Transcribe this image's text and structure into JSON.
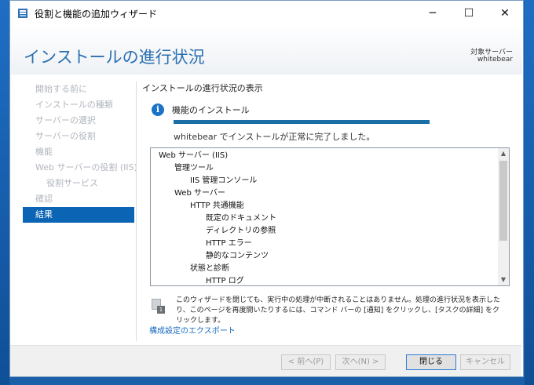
{
  "window": {
    "title": "役割と機能の追加ウィザード",
    "minimize_glyph": "─",
    "maximize_glyph": "☐",
    "close_glyph": "✕"
  },
  "header": {
    "page_title": "インストールの進行状況",
    "target_label": "対象サーバー",
    "target_server": "whitebear"
  },
  "sidebar": {
    "items": [
      {
        "label": "開始する前に",
        "sub": false,
        "active": false
      },
      {
        "label": "インストールの種類",
        "sub": false,
        "active": false
      },
      {
        "label": "サーバーの選択",
        "sub": false,
        "active": false
      },
      {
        "label": "サーバーの役割",
        "sub": false,
        "active": false
      },
      {
        "label": "機能",
        "sub": false,
        "active": false
      },
      {
        "label": "Web サーバーの役割 (IIS)",
        "sub": false,
        "active": false
      },
      {
        "label": "役割サービス",
        "sub": true,
        "active": false
      },
      {
        "label": "確認",
        "sub": false,
        "active": false
      },
      {
        "label": "結果",
        "sub": false,
        "active": true
      }
    ]
  },
  "content": {
    "section_title": "インストールの進行状況の表示",
    "info_glyph": "i",
    "feature_install_label": "機能のインストール",
    "progress_percent": 100,
    "status_text": "whitebear でインストールが正常に完了しました。"
  },
  "results": {
    "rows": [
      {
        "text": "Web サーバー (IIS)",
        "level": 0
      },
      {
        "text": "管理ツール",
        "level": 1
      },
      {
        "text": "IIS 管理コンソール",
        "level": 2
      },
      {
        "text": "Web サーバー",
        "level": 1
      },
      {
        "text": "HTTP 共通機能",
        "level": 2
      },
      {
        "text": "既定のドキュメント",
        "level": 3
      },
      {
        "text": "ディレクトリの参照",
        "level": 3
      },
      {
        "text": "HTTP エラー",
        "level": 3
      },
      {
        "text": "静的なコンテンツ",
        "level": 3
      },
      {
        "text": "状態と診断",
        "level": 2
      },
      {
        "text": "HTTP ログ",
        "level": 3
      }
    ],
    "scroll_up_glyph": "▲",
    "scroll_down_glyph": "▼"
  },
  "note": {
    "badge": "1",
    "text": "このウィザードを閉じても、実行中の処理が中断されることはありません。処理の進行状況を表示したり、このページを再度開いたりするには、コマンド バーの [通知] をクリックし、[タスクの詳細] をクリックします。"
  },
  "export_link": "構成設定のエクスポート",
  "footer": {
    "prev_label": "< 前へ(P)",
    "next_label": "次へ(N) >",
    "close_label": "閉じる",
    "cancel_label": "キャンセル"
  },
  "colors": {
    "accent": "#0b64b4",
    "title": "#2a6fb1",
    "progress": "#1a6fa6",
    "link": "#1a6bc1"
  }
}
